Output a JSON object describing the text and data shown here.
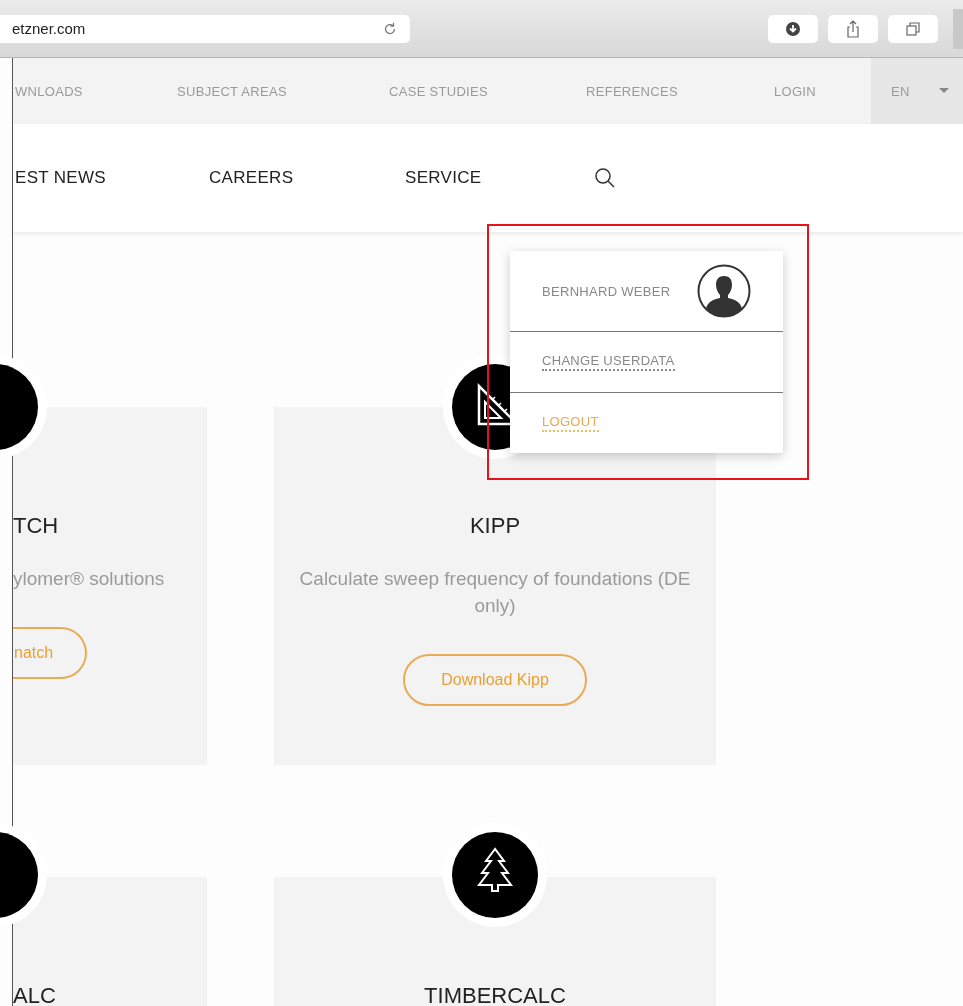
{
  "browser": {
    "address": "etzner.com"
  },
  "top_nav": {
    "items": [
      "WNLOADS",
      "SUBJECT AREAS",
      "CASE STUDIES",
      "REFERENCES",
      "LOGIN"
    ],
    "language": "EN"
  },
  "main_nav": {
    "items": [
      "EST NEWS",
      "CAREERS",
      "SERVICE"
    ]
  },
  "cards": [
    {
      "title": "TCH",
      "description": "ylomer® solutions",
      "button": "natch"
    },
    {
      "title": "KIPP",
      "description": "Calculate sweep frequency of foundations (DE only)",
      "button": "Download Kipp"
    },
    {
      "title": "ALC"
    },
    {
      "title": "TIMBERCALC"
    }
  ],
  "user_menu": {
    "name": "BERNHARD WEBER",
    "items": [
      {
        "label": "CHANGE USERDATA",
        "kind": "link"
      },
      {
        "label": "LOGOUT",
        "kind": "logout"
      }
    ]
  }
}
